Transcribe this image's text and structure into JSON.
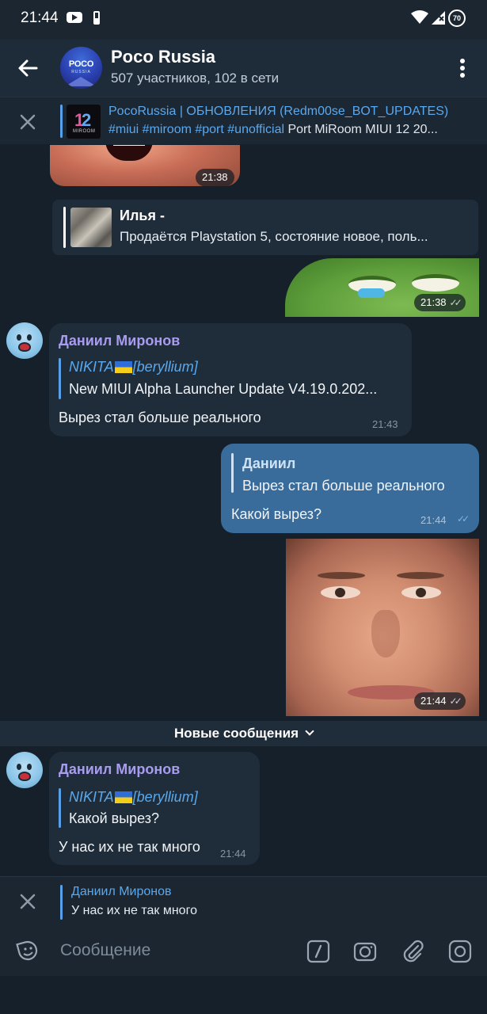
{
  "status": {
    "time": "21:44",
    "battery": "70"
  },
  "header": {
    "title": "Poco Russia",
    "subtitle": "507 участников, 102 в сети",
    "avatar_text": "POCO",
    "avatar_sub": "RUSSIA"
  },
  "pinned": {
    "title": "PocoRussia | ОБНОВЛЕНИЯ (Redm00se_BOT_UPDATES)",
    "tags": "#miui #miroom #port #unofficial",
    "text": "Port MiRoom MIUI 12 20..."
  },
  "messages": {
    "sticker1_time": "21:38",
    "reply_card": {
      "name": "Илья -",
      "text": "Продаётся Playstation 5, состояние новое, поль..."
    },
    "pepe_time": "21:38",
    "msg1": {
      "sender": "Даниил Миронов",
      "quote_name_a": "NIKITA",
      "quote_name_b": "[beryllium]",
      "quote_text": "New MIUI Alpha Launcher Update V4.19.0.202...",
      "text": "Вырез стал больше реального",
      "time": "21:43"
    },
    "msg2": {
      "quote_name": "Даниил",
      "quote_text": "Вырез стал больше реального",
      "text": "Какой вырез?",
      "time": "21:44"
    },
    "photo_time": "21:44",
    "new_messages": "Новые сообщения",
    "msg3": {
      "sender": "Даниил Миронов",
      "quote_name_a": "NIKITA",
      "quote_name_b": "[beryllium]",
      "quote_text": "Какой вырез?",
      "text": "У нас их не так много",
      "time": "21:44"
    }
  },
  "reply_preview": {
    "name": "Даниил Миронов",
    "text": "У нас их не так много"
  },
  "input": {
    "placeholder": "Сообщение"
  }
}
